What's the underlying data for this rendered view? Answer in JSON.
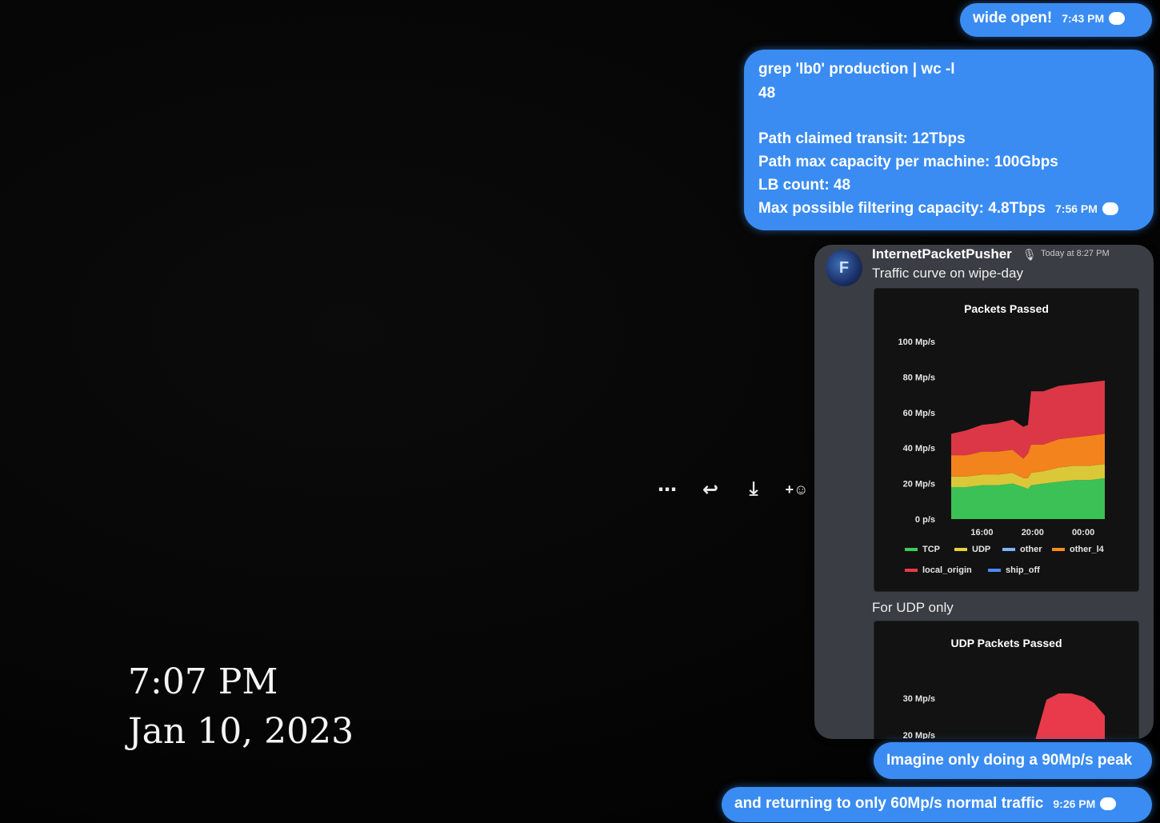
{
  "overlay": {
    "time": "7:07 PM",
    "date": "Jan 10, 2023"
  },
  "messages": {
    "wide_open": {
      "text": "wide open!",
      "time": "7:43 PM"
    },
    "grep": {
      "lines": [
        "grep 'lb0' production  | wc -l",
        "48",
        "",
        "Path claimed transit: 12Tbps",
        "Path max capacity per machine: 100Gbps",
        "LB count: 48",
        "Max possible filtering capacity: 4.8Tbps"
      ],
      "time": "7:56 PM"
    },
    "shared": {
      "avatar_letter": "F",
      "username": "InternetPacketPusher",
      "timestamp": "Today at 8:27 PM",
      "caption1": "Traffic curve on wipe-day",
      "caption2": "For UDP only"
    },
    "imagine": {
      "text": "Imagine only doing a 90Mp/s peak"
    },
    "returning": {
      "text": "and returning to only 60Mp/s normal traffic",
      "time": "9:26 PM"
    }
  },
  "actions": {
    "more": "⋯",
    "reply": "↩",
    "download": "⤓",
    "react": "+☺"
  },
  "chart_data": [
    {
      "type": "area",
      "title": "Packets Passed",
      "x_ticks": [
        "16:00",
        "20:00",
        "00:00"
      ],
      "y_ticks": [
        "0 p/s",
        "20 Mp/s",
        "40 Mp/s",
        "60 Mp/s",
        "80 Mp/s",
        "100 Mp/s"
      ],
      "ylim": [
        0,
        100
      ],
      "stacked": true,
      "legend": [
        "TCP",
        "UDP",
        "other",
        "other_l4",
        "local_origin",
        "ship_off"
      ],
      "legend_colors": [
        "#3ecb5a",
        "#e6d33c",
        "#7fb3ff",
        "#ff8a1f",
        "#e83a4a",
        "#4c8bff"
      ],
      "x_positions": [
        0,
        0.1,
        0.2,
        0.3,
        0.4,
        0.47,
        0.5,
        0.52,
        0.6,
        0.7,
        0.8,
        0.9,
        1
      ],
      "series": [
        {
          "name": "TCP",
          "color": "#3ecb5a",
          "values": [
            18,
            18,
            19,
            19,
            20,
            18,
            17,
            19,
            20,
            21,
            22,
            22,
            23
          ]
        },
        {
          "name": "UDP",
          "color": "#e6d33c",
          "values": [
            6,
            6,
            6,
            6,
            6,
            5,
            6,
            7,
            7,
            8,
            8,
            8,
            8
          ]
        },
        {
          "name": "other_l4",
          "color": "#ff8a1f",
          "values": [
            12,
            12,
            13,
            13,
            13,
            11,
            14,
            16,
            15,
            16,
            16,
            17,
            17
          ]
        },
        {
          "name": "local_origin",
          "color": "#e83a4a",
          "values": [
            12,
            14,
            15,
            16,
            17,
            18,
            16,
            30,
            30,
            30,
            30,
            30,
            30
          ]
        }
      ]
    },
    {
      "type": "area",
      "title": "UDP Packets Passed",
      "y_ticks": [
        "30 Mp/s",
        "20 Mp/s"
      ],
      "x_positions": [
        0.55,
        0.62,
        0.7,
        0.78,
        0.86,
        0.93,
        1
      ],
      "series": [
        {
          "name": "UDP",
          "color": "#e83a4a",
          "values": [
            2,
            26,
            30,
            30,
            28,
            24,
            16
          ]
        }
      ]
    }
  ]
}
